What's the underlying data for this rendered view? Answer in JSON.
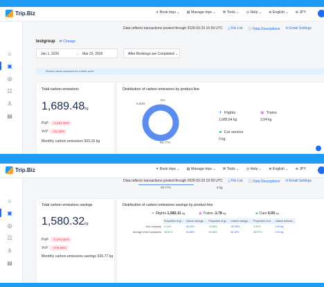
{
  "logo": "Trip.Biz",
  "menu": {
    "book": "Book trips ⌄",
    "manage": "Manage trips ⌄",
    "tools": "Tools ⌄",
    "help": "Help ⌄",
    "lang": "English ⌄",
    "currency": "JPY"
  },
  "info": {
    "notice": "Data reflects transactions posted through 2026-03-23 15:59 UTC",
    "file_list": "File List",
    "data_desc": "Data Descriptions",
    "email": "Email Settings"
  },
  "filters": {
    "company": "testgroup",
    "change": "Change",
    "start_date": "Jan 1, 2026",
    "end_date": "Mar 23, 2026",
    "status": "After Bookings are Completed ⌄"
  },
  "banner": "Reduce carbon emissions for a better world",
  "emissions": {
    "title": "Total carbon emissions",
    "value": "1,689.48",
    "unit": "kg",
    "pop_label": "PoP",
    "pop_value": "↑3,122.39%",
    "yoy_label": "YoY",
    "yoy_value": "↑23.25%",
    "monthly_label": "Monthly carbon emissions",
    "monthly_value": "563.16 kg"
  },
  "distribution": {
    "title": "Distribution of carbon emissions by product line",
    "pct_left": "0.03%",
    "pct_top": "0%",
    "pct_bottom": "99.77%",
    "flights_label": "Flights",
    "flights_value": "1,685.54 kg",
    "trains_label": "Trains",
    "trains_value": "3.94 kg",
    "car_label": "Car service",
    "car_value": "0 kg"
  },
  "savings": {
    "title": "Total carbon emissions savings",
    "value": "1,580.32",
    "unit": "kg",
    "pop_label": "PoP",
    "pop_value": "↑5,970.66%",
    "yoy_label": "YoY",
    "yoy_value": "↑378.65%",
    "monthly_label": "Monthly carbon emissions savings",
    "monthly_value": "526.77 kg",
    "scroll_pct": "99.77%",
    "scroll_kg": "0 kg"
  },
  "savings_dist": {
    "title": "Distribution of carbon emissions savings by product line",
    "flights_label": "Flights",
    "flights_value": "1,582.11",
    "trains_label": "Trains",
    "trains_value": "-1.78",
    "cars_label": "Cars",
    "cars_value": "0.00",
    "unit": "kg",
    "headers": [
      "Proportion of gr...",
      "Carbon savings ...",
      "Proportion of gr...",
      "Carbon savings ...",
      "Proportion of al...",
      "Carbon emissio..."
    ],
    "row1_label": "Your company",
    "row1": [
      "6.14%",
      "98.42%",
      "73.65%",
      "-82.58%",
      "0.00%",
      "0.00 kg"
    ],
    "row2_label": "Average of All Companies",
    "row2": [
      "48.61%",
      "16.56%",
      "55.58%",
      "58.16%",
      "58.57%",
      "0.00 kg"
    ]
  },
  "colors": {
    "accent": "#1e6cf0",
    "donut": "#5b8def",
    "up": "#e5484d"
  }
}
